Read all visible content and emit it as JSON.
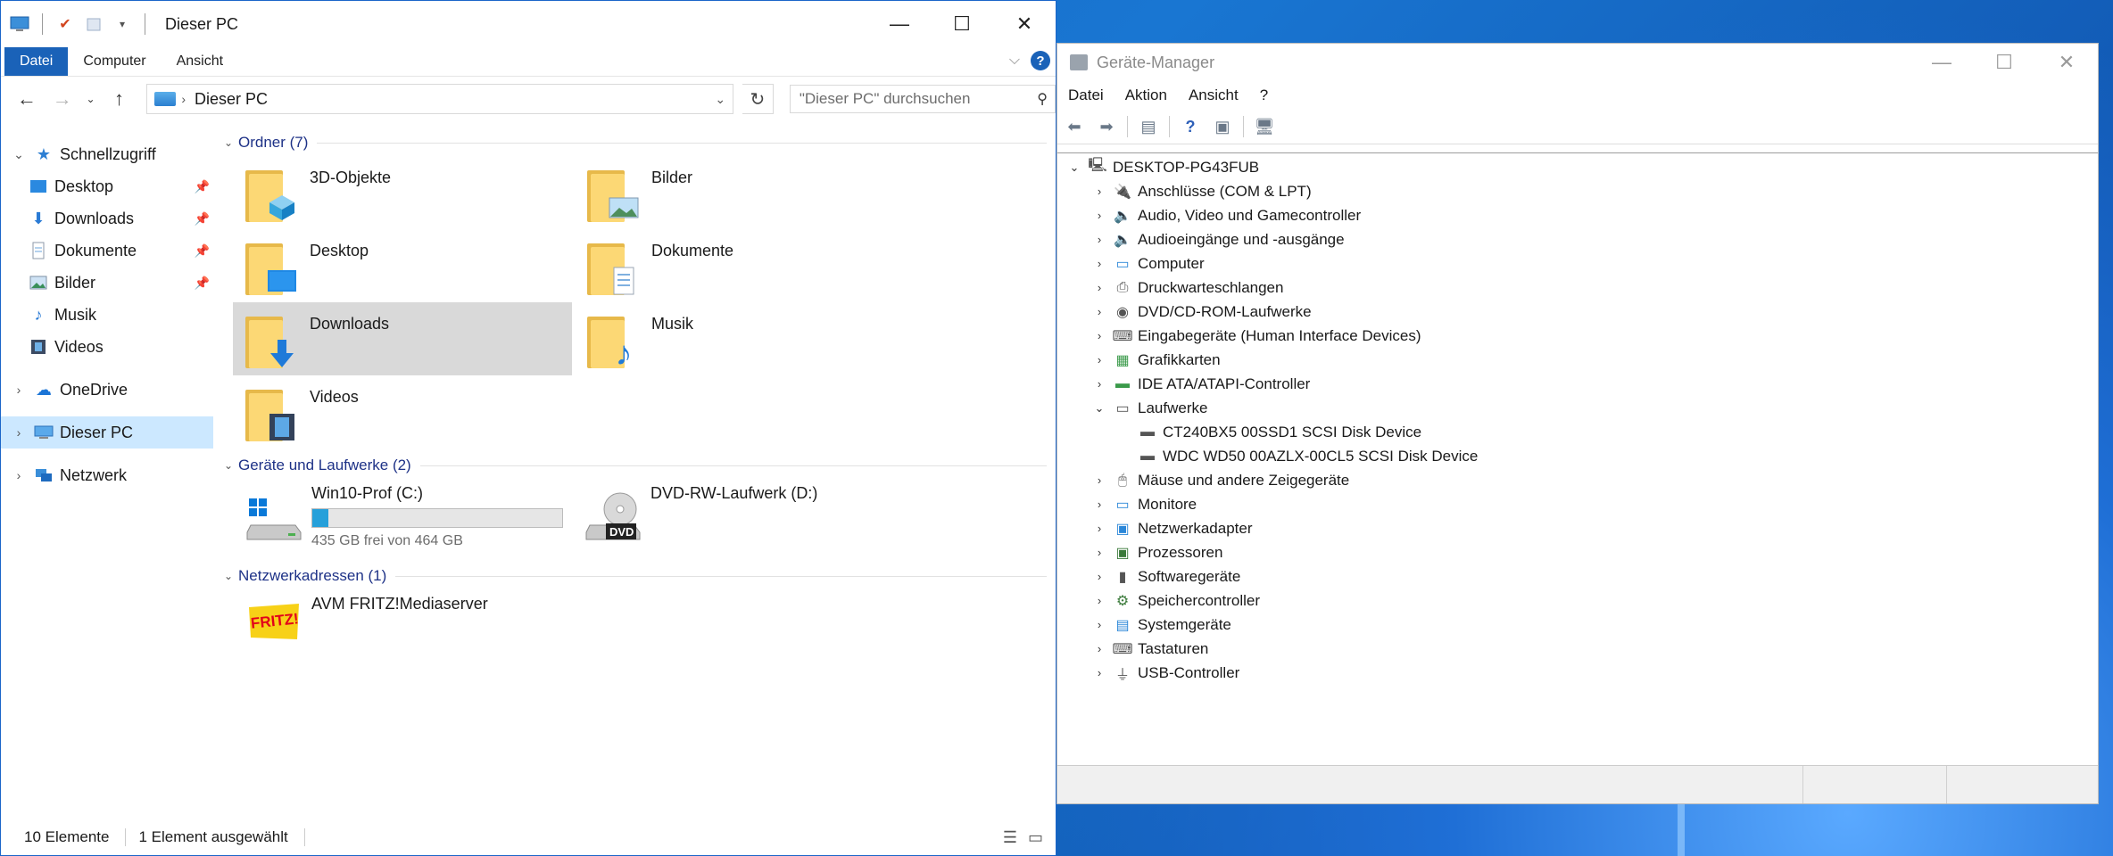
{
  "explorer": {
    "title": "Dieser PC",
    "ribbon_tabs": [
      "Datei",
      "Computer",
      "Ansicht"
    ],
    "address": "Dieser PC",
    "search_placeholder": "\"Dieser PC\" durchsuchen",
    "nav": {
      "quick_access": "Schnellzugriff",
      "quick_items": [
        "Desktop",
        "Downloads",
        "Dokumente",
        "Bilder",
        "Musik",
        "Videos"
      ],
      "onedrive": "OneDrive",
      "this_pc": "Dieser PC",
      "network": "Netzwerk"
    },
    "groups": {
      "folders_header": "Ordner (7)",
      "folders": [
        "3D-Objekte",
        "Bilder",
        "Desktop",
        "Dokumente",
        "Downloads",
        "Musik",
        "Videos"
      ],
      "selected_folder": "Downloads",
      "drives_header": "Geräte und Laufwerke (2)",
      "drive_c": {
        "name": "Win10-Prof (C:)",
        "free_text": "435 GB frei von 464 GB",
        "used_fraction": 0.0625
      },
      "drive_d": {
        "name": "DVD-RW-Laufwerk (D:)",
        "badge": "DVD"
      },
      "network_header": "Netzwerkadressen (1)",
      "network_items": [
        "AVM FRITZ!Mediaserver"
      ],
      "fritz_logo": "FRITZ!"
    },
    "status": {
      "count": "10 Elemente",
      "selected": "1 Element ausgewählt"
    }
  },
  "devmgr": {
    "title": "Geräte-Manager",
    "menu": [
      "Datei",
      "Aktion",
      "Ansicht",
      "?"
    ],
    "root": "DESKTOP-PG43FUB",
    "categories": [
      "Anschlüsse (COM & LPT)",
      "Audio, Video und Gamecontroller",
      "Audioeingänge und -ausgänge",
      "Computer",
      "Druckwarteschlangen",
      "DVD/CD-ROM-Laufwerke",
      "Eingabegeräte (Human Interface Devices)",
      "Grafikkarten",
      "IDE ATA/ATAPI-Controller",
      "Laufwerke"
    ],
    "disks": [
      "CT240BX5 00SSD1 SCSI Disk Device",
      "WDC WD50 00AZLX-00CL5 SCSI Disk Device"
    ],
    "categories_after": [
      "Mäuse und andere Zeigegeräte",
      "Monitore",
      "Netzwerkadapter",
      "Prozessoren",
      "Softwaregeräte",
      "Speichercontroller",
      "Systemgeräte",
      "Tastaturen",
      "USB-Controller"
    ]
  },
  "colors": {
    "accent": "#1a62b8",
    "selection": "#cce8ff",
    "desktop": "#1565c0",
    "drive_fill": "#26a0da"
  }
}
